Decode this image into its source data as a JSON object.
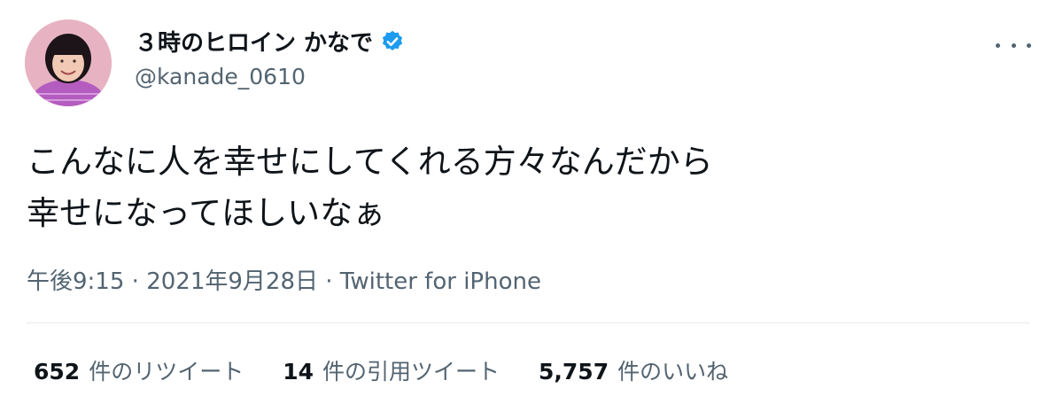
{
  "author": {
    "display_name": "３時のヒロイン かなで",
    "handle": "@kanade_0610",
    "verified": true
  },
  "tweet": {
    "lines": [
      "こんなに人を幸せにしてくれる方々なんだから",
      "幸せになってほしいなぁ"
    ]
  },
  "meta": {
    "time": "午後9:15",
    "sep1": " · ",
    "date": "2021年9月28日",
    "sep2": " · ",
    "source": "Twitter for iPhone"
  },
  "stats": {
    "retweets": {
      "count": "652",
      "label": "件のリツイート"
    },
    "quotes": {
      "count": "14",
      "label": "件の引用ツイート"
    },
    "likes": {
      "count": "5,757",
      "label": "件のいいね"
    }
  },
  "icons": {
    "verified": "verified-badge-icon",
    "more": "more-options-icon"
  },
  "colors": {
    "text": "#0f1419",
    "secondary": "#536471",
    "verified": "#1d9bf0",
    "divider": "#e6ecf0"
  }
}
